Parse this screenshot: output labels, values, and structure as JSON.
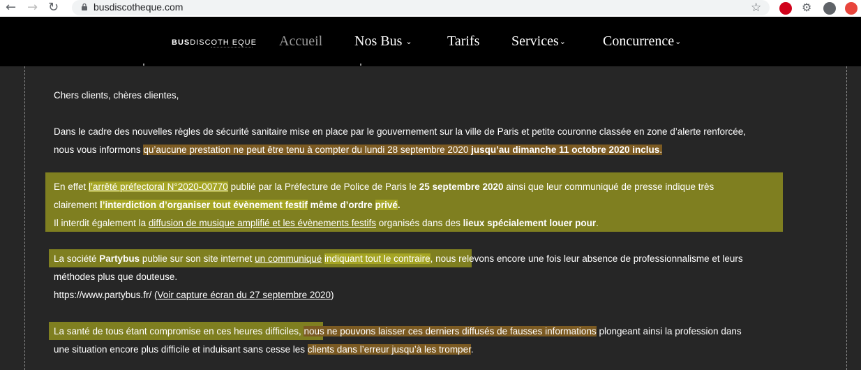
{
  "browser": {
    "url": "busdiscotheque.com",
    "icons": [
      "back-icon",
      "forward-icon",
      "reload-icon",
      "home-icon",
      "star-icon",
      "extension-icon",
      "profile-icon",
      "update-icon"
    ]
  },
  "site": {
    "logo_bold": "BUS",
    "logo_rest": "DISCOTH EQUE",
    "nav": [
      {
        "label": "Accueil"
      },
      {
        "label": "Nos Bus"
      },
      {
        "label": "Tarifs"
      },
      {
        "label": "Services"
      },
      {
        "label": "Concurrence"
      }
    ]
  },
  "content": {
    "greeting": "Chers clients, chères clientes,",
    "p1": {
      "l1": "Dans le cadre des nouvelles règles de sécurité sanitaire mise en place par le gouvernement sur la ville de Paris et petite couronne classée en zone d’alerte renforcée,",
      "l2a": "nous vous informons ",
      "l2b": "qu’aucune prestation ne peut être tenu à compter du lundi 28 septembre 2020 ",
      "l2c": "jusqu’au dimanche 11 octobre 2020 inclus",
      "l2d": "."
    },
    "p2": {
      "a1": "En effet ",
      "a2": "l’arrêté préfectoral N°2020-00770",
      "a3": " publié par la Préfecture de Police de Paris le ",
      "a4": "25 septembre 2020",
      "a5": " ainsi que leur communiqué de presse indique très",
      "b1": "clairement ",
      "b2": "l’interdiction d’organiser tout évènement festif",
      "b3": " même d’ordre ",
      "b4": "privé",
      "b5": ".",
      "c1": "Il interdit également la ",
      "c2": "diffusion de musique amplifié et les évènements festifs",
      "c3": " organisés dans des ",
      "c4": "lieux spécialement louer pour",
      "c5": "."
    },
    "p3": {
      "a1": "La société ",
      "a2": "Partybus",
      "a3": " publie sur son site internet ",
      "a4": "un communiqué",
      "a5": " ",
      "a6": "indiquant tout le contraire",
      "a7": ", nous relevons encore une fois leur absence de professionnalisme et leurs",
      "b1": "méthodes plus que douteuse.",
      "c1": "https://www.partybus.fr/ (",
      "c2": "Voir capture écran du 27 septembre 2020",
      "c3": ")"
    },
    "p4": {
      "a1": "La santé de tous étant compromise en ces heures difficiles,",
      "a2": " ",
      "a3": "nous ne pouvons laisser ces derniers diffusés de fausses informations",
      "a4": " plongeant ainsi la profession dans",
      "b1": "une situation encore plus difficile et induisant sans cesse les ",
      "b2": "clients dans l’erreur jusqu’à les tromper",
      "b3": "."
    }
  }
}
